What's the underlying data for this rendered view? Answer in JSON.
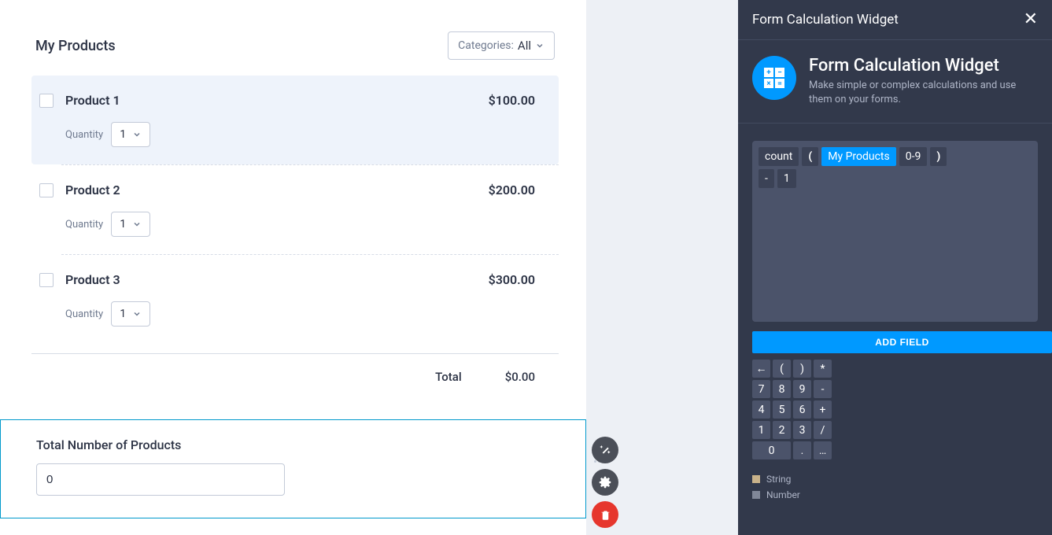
{
  "section": {
    "title": "My Products",
    "category_label": "Categories:",
    "category_value": "All"
  },
  "products": [
    {
      "name": "Product 1",
      "price": "$100.00",
      "qty_label": "Quantity",
      "qty_value": "1",
      "selected": true
    },
    {
      "name": "Product 2",
      "price": "$200.00",
      "qty_label": "Quantity",
      "qty_value": "1",
      "selected": false
    },
    {
      "name": "Product 3",
      "price": "$300.00",
      "qty_label": "Quantity",
      "qty_value": "1",
      "selected": false
    }
  ],
  "total": {
    "label": "Total",
    "value": "$0.00"
  },
  "field": {
    "label": "Total Number of Products",
    "value": "0"
  },
  "panel": {
    "titlebar": "Form Calculation Widget",
    "title": "Form Calculation Widget",
    "subtitle": "Make simple or complex calculations and use them on your forms.",
    "formula": {
      "line1": [
        {
          "text": "count",
          "cls": "fn"
        },
        {
          "text": "(",
          "cls": "paren"
        },
        {
          "text": "My Products",
          "cls": "field"
        },
        {
          "text": "0-9",
          "cls": "op09"
        },
        {
          "text": ")",
          "cls": "paren"
        }
      ],
      "line2": [
        {
          "text": "-",
          "cls": "num"
        },
        {
          "text": "1",
          "cls": "num"
        }
      ]
    },
    "add_field": "ADD FIELD",
    "keypad": [
      [
        "←",
        "(",
        ")",
        "*"
      ],
      [
        "7",
        "8",
        "9",
        "-"
      ],
      [
        "4",
        "5",
        "6",
        "+"
      ],
      [
        "1",
        "2",
        "3",
        "/"
      ],
      [
        "0",
        ".",
        "…"
      ]
    ],
    "legend": [
      {
        "label": "String",
        "cls": "str"
      },
      {
        "label": "Number",
        "cls": "num"
      }
    ]
  }
}
